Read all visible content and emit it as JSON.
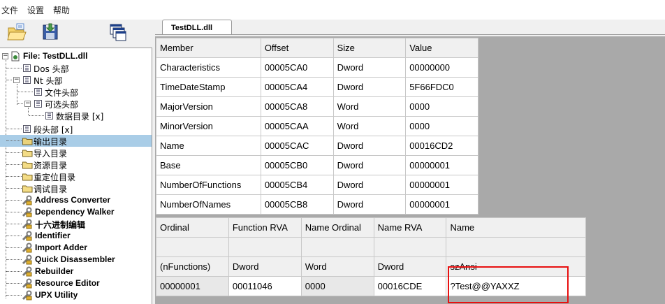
{
  "menu": {
    "items": [
      "文件",
      "设置",
      "帮助"
    ]
  },
  "toolbar": {
    "buttons": [
      "open-file-icon",
      "save-file-icon",
      "windows-icon"
    ]
  },
  "tree": {
    "root": "File: TestDLL.dll",
    "dos_header": "Dos 头部",
    "nt_header": "Nt 头部",
    "file_header": "文件头部",
    "optional_header": "可选头部",
    "data_directories": "数据目录 [x]",
    "section_headers": "段头部 [x]",
    "export_directory": "输出目录",
    "import_directory": "导入目录",
    "resource_directory": "资源目录",
    "relocation_directory": "重定位目录",
    "debug_directory": "调试目录",
    "address_converter": "Address Converter",
    "dependency_walker": "Dependency Walker",
    "hex_editor": "十六进制编辑",
    "identifier": "Identifier",
    "import_adder": "Import Adder",
    "quick_disassembler": "Quick Disassembler",
    "rebuilder": "Rebuilder",
    "resource_editor": "Resource Editor",
    "upx_utility": "UPX Utility"
  },
  "tab": {
    "label": "TestDLL.dll"
  },
  "export_table": {
    "headers": [
      "Member",
      "Offset",
      "Size",
      "Value"
    ],
    "rows": [
      [
        "Characteristics",
        "00005CA0",
        "Dword",
        "00000000"
      ],
      [
        "TimeDateStamp",
        "00005CA4",
        "Dword",
        "5F66FDC0"
      ],
      [
        "MajorVersion",
        "00005CA8",
        "Word",
        "0000"
      ],
      [
        "MinorVersion",
        "00005CAA",
        "Word",
        "0000"
      ],
      [
        "Name",
        "00005CAC",
        "Dword",
        "00016CD2"
      ],
      [
        "Base",
        "00005CB0",
        "Dword",
        "00000001"
      ],
      [
        "NumberOfFunctions",
        "00005CB4",
        "Dword",
        "00000001"
      ],
      [
        "NumberOfNames",
        "00005CB8",
        "Dword",
        "00000001"
      ]
    ]
  },
  "functions_table": {
    "headers": [
      "Ordinal",
      "Function RVA",
      "Name Ordinal",
      "Name RVA",
      "Name"
    ],
    "empty_row": [
      "",
      "",
      "",
      "",
      ""
    ],
    "type_row": [
      "(nFunctions)",
      "Dword",
      "Word",
      "Dword",
      "szAnsi"
    ],
    "data_row": [
      "00000001",
      "00011046",
      "0000",
      "00016CDE",
      "?Test@@YAXXZ"
    ]
  },
  "colors": {
    "selection": "#a9cde7",
    "highlight": "#e81010",
    "grid_bg": "#a9a9a9"
  }
}
